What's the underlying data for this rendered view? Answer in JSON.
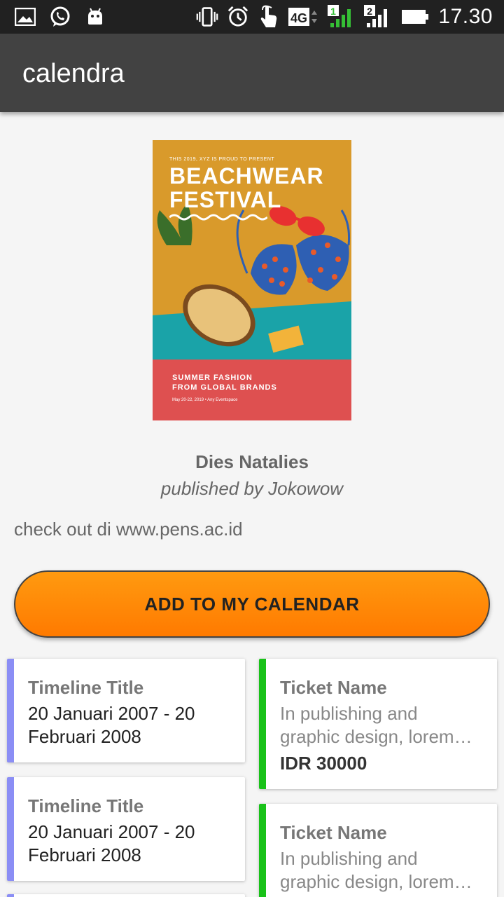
{
  "status_bar": {
    "time": "17.30",
    "left_icons": [
      "gallery-icon",
      "whatsapp-icon",
      "android-icon"
    ],
    "right_icons": [
      "vibrate-icon",
      "alarm-icon",
      "touch-icon",
      "network-4g-icon",
      "signal-sim1-icon",
      "signal-sim2-icon",
      "battery-icon"
    ],
    "network_label": "4G",
    "sim1_label": "1",
    "sim2_label": "2"
  },
  "app_bar": {
    "title": "calendra"
  },
  "poster": {
    "small_text": "THIS 2019, XYZ IS PROUD TO PRESENT",
    "title_line1": "BEACHWEAR",
    "title_line2": "FESTIVAL",
    "subtitle_line1": "SUMMER FASHION",
    "subtitle_line2": "FROM GLOBAL BRANDS",
    "date_text": "May 20-22, 2019 • Any Eventspace"
  },
  "event": {
    "name": "Dies Natalies",
    "publisher": "published by Jokowow",
    "description": "check out di www.pens.ac.id"
  },
  "add_button": {
    "label": "ADD TO MY CALENDAR"
  },
  "timeline": [
    {
      "title": "Timeline Title",
      "date_line1": "20 Januari 2007 - 20",
      "date_line2": "Februari 2008"
    },
    {
      "title": "Timeline Title",
      "date_line1": "20 Januari 2007 - 20",
      "date_line2": "Februari 2008"
    }
  ],
  "tickets": [
    {
      "name": "Ticket Name",
      "desc_line1": "In publishing and",
      "desc_line2": "graphic design, lorem…",
      "price": "IDR 30000"
    },
    {
      "name": "Ticket Name",
      "desc_line1": "In publishing and",
      "desc_line2": "graphic design, lorem…"
    }
  ],
  "colors": {
    "status_bar": "#212121",
    "app_bar": "#424242",
    "button_orange": "#ff8a00",
    "timeline_accent": "#8b8ef5",
    "ticket_accent": "#19c219"
  }
}
